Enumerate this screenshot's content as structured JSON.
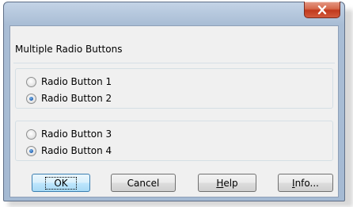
{
  "window": {
    "title": "",
    "close_icon": "close-icon"
  },
  "header": {
    "label": "Multiple Radio Buttons"
  },
  "groups": [
    {
      "options": [
        {
          "label": "Radio Button 1",
          "checked": false
        },
        {
          "label": "Radio Button 2",
          "checked": true
        }
      ]
    },
    {
      "options": [
        {
          "label": "Radio Button 3",
          "checked": false
        },
        {
          "label": "Radio Button 4",
          "checked": true
        }
      ]
    }
  ],
  "buttons": {
    "ok": "OK",
    "cancel": "Cancel",
    "help_accel": "H",
    "help_rest": "elp",
    "info_accel": "I",
    "info_rest": "nfo..."
  },
  "colors": {
    "close_button": "#c74a2e",
    "titlebar": "#a9bdd5",
    "radio_dot": "#1f5fb0",
    "default_button_border": "#3c7fb1"
  }
}
